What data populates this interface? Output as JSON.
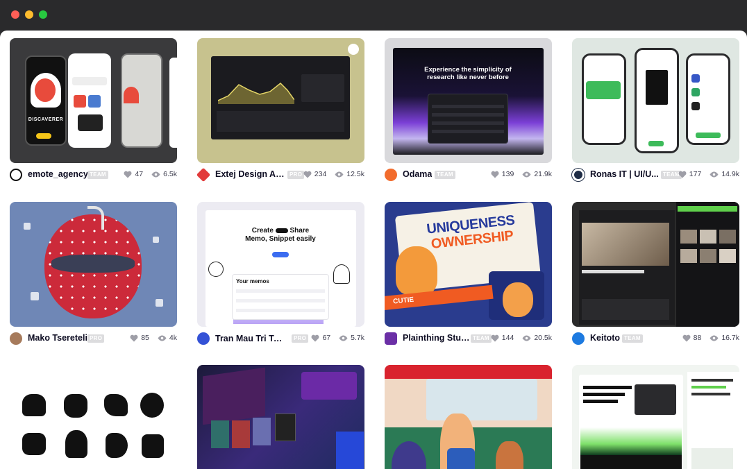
{
  "window": {
    "controls": [
      "close",
      "minimize",
      "zoom"
    ]
  },
  "cards": [
    {
      "author": "emote_agency",
      "badge": "TEAM",
      "likes": "47",
      "views": "6.5k",
      "preview": {
        "heading": "DISCAVERER"
      }
    },
    {
      "author": "Extej Design Ag...",
      "badge": "PRO",
      "likes": "234",
      "views": "12.5k"
    },
    {
      "author": "Odama",
      "badge": "TEAM",
      "likes": "139",
      "views": "21.9k",
      "preview": {
        "headline": "Experience the simplicity of research like never before"
      }
    },
    {
      "author": "Ronas IT | UI/U...",
      "badge": "TEAM",
      "likes": "177",
      "views": "14.9k"
    },
    {
      "author": "Mako Tsereteli",
      "badge": "PRO",
      "likes": "85",
      "views": "4k"
    },
    {
      "author": "Tran Mau Tri Tam ✪",
      "badge": "PRO",
      "likes": "67",
      "views": "5.7k",
      "preview": {
        "headline_1": "Create",
        "headline_2": "Share",
        "headline_3": "Memo, Snippet easily",
        "panel_title": "Your memos"
      }
    },
    {
      "author": "Plainthing Studio",
      "badge": "TEAM",
      "likes": "144",
      "views": "20.5k",
      "preview": {
        "headline_1": "UNIQUENESS",
        "headline_2": "OWNERSHIP",
        "ribbon": "CUTIE"
      }
    },
    {
      "author": "Keitoto",
      "badge": "TEAM",
      "likes": "88",
      "views": "16.7k"
    },
    {},
    {},
    {},
    {}
  ],
  "colors": {
    "accent": "#ea4c89",
    "badge": "#dcdcde",
    "text": "#0d0c22"
  },
  "icons": {
    "likes": "heart-icon",
    "views": "eye-icon"
  }
}
